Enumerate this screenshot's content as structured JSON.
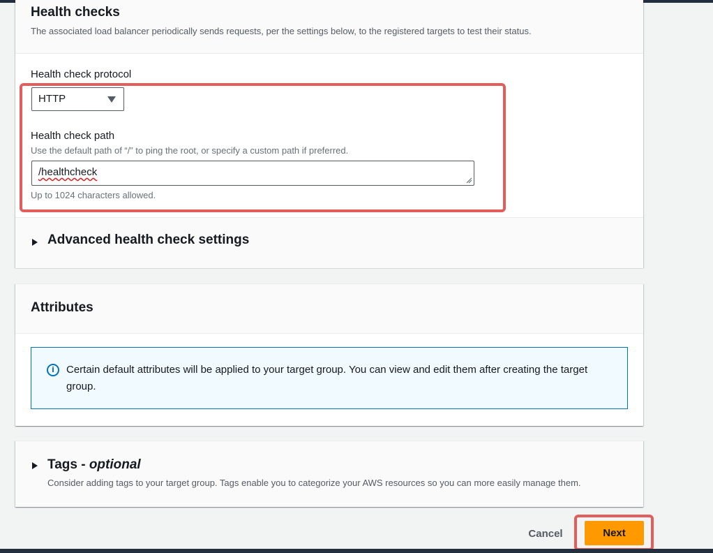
{
  "health_checks": {
    "title": "Health checks",
    "description": "The associated load balancer periodically sends requests, per the settings below, to the registered targets to test their status.",
    "protocol_label": "Health check protocol",
    "protocol_value": "HTTP",
    "path_label": "Health check path",
    "path_hint": "Use the default path of “/” to ping the root, or specify a custom path if preferred.",
    "path_value": "/healthcheck",
    "path_constraint": "Up to 1024 characters allowed.",
    "advanced_label": "Advanced health check settings"
  },
  "attributes": {
    "title": "Attributes",
    "info_text": "Certain default attributes will be applied to your target group. You can view and edit them after creating the target group.",
    "info_icon": "info-icon"
  },
  "tags": {
    "title": "Tags - ",
    "title_optional": "optional",
    "description": "Consider adding tags to your target group. Tags enable you to categorize your AWS resources so you can more easily manage them."
  },
  "footer": {
    "cancel_label": "Cancel",
    "next_label": "Next"
  },
  "colors": {
    "accent": "#ff9900",
    "highlight": "#e35d5d",
    "info": "#0073bb"
  }
}
